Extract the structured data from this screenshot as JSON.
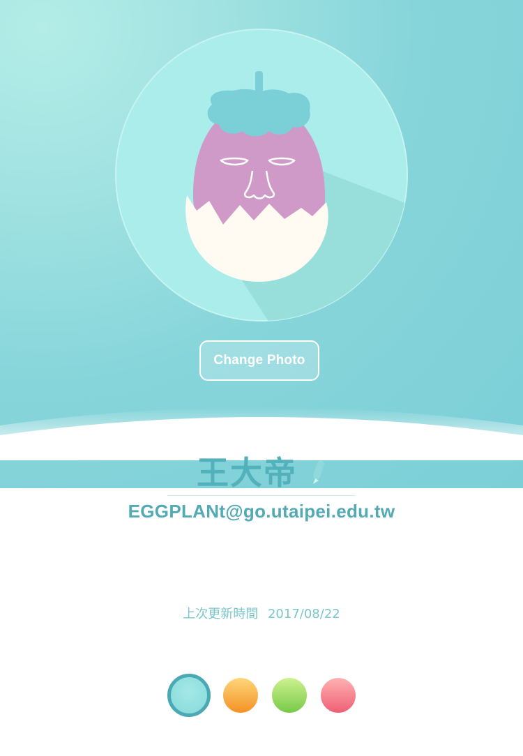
{
  "profile": {
    "change_photo_label": "Change Photo",
    "name": "王大帝",
    "email": "EGGPLANt@go.utaipei.edu.tw",
    "last_updated_label": "上次更新時間",
    "last_updated_date": "2017/08/22"
  },
  "colors": {
    "header_teal": "#7ccfd7",
    "accent_text": "#52b1ba",
    "theme_options": [
      "#86d9db",
      "#f39225",
      "#78c948",
      "#ee5f74"
    ],
    "selected_theme": "#86d9db"
  },
  "icons": {
    "avatar": "eggplant-in-eggshell-illustration",
    "edit": "pencil-icon"
  },
  "theme_picker": {
    "options": [
      "teal",
      "orange",
      "green",
      "pink"
    ],
    "selected": "teal"
  }
}
